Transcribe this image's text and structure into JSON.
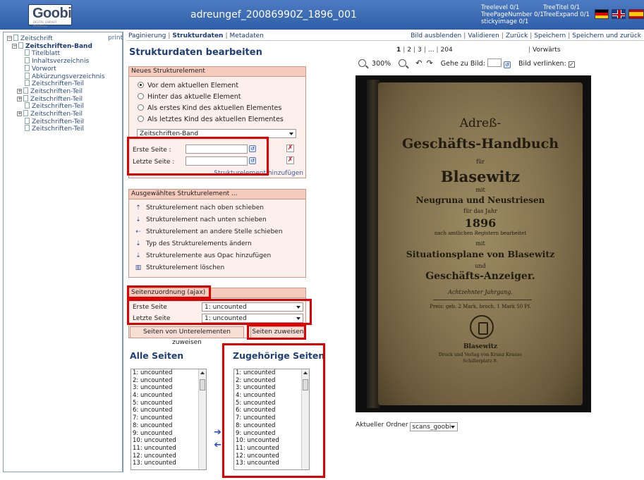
{
  "header": {
    "logo_text": "Goobi",
    "logo_subtext": "DIGITAL LIBRARY MODULES",
    "document_title": "adreungef_20086990Z_1896_001",
    "meta_left": [
      "Treelevel 0/1",
      "TreePageNumber 0/1",
      "stickyimage 0/1"
    ],
    "meta_right": [
      "TreeTitel 0/1",
      "TreeExpand 0/1"
    ]
  },
  "tree": {
    "print_label": "print",
    "nodes": [
      {
        "label": "Zeitschrift",
        "expander": "−",
        "level": 0
      },
      {
        "label": "Zeitschriften-Band",
        "expander": "−",
        "level": 1,
        "bold": true
      },
      {
        "label": "Titelblatt",
        "expander": "",
        "level": 2
      },
      {
        "label": "Inhaltsverzeichnis",
        "expander": "",
        "level": 2
      },
      {
        "label": "Vorwort",
        "expander": "",
        "level": 2
      },
      {
        "label": "Abkürzungsverzeichnis",
        "expander": "",
        "level": 2
      },
      {
        "label": "Zeitschriften-Teil",
        "expander": "",
        "level": 2
      },
      {
        "label": "Zeitschriften-Teil",
        "expander": "+",
        "level": 2
      },
      {
        "label": "Zeitschriften-Teil",
        "expander": "+",
        "level": 2
      },
      {
        "label": "Zeitschriften-Teil",
        "expander": "",
        "level": 2
      },
      {
        "label": "Zeitschriften-Teil",
        "expander": "+",
        "level": 2
      },
      {
        "label": "Zeitschriften-Teil",
        "expander": "",
        "level": 2
      },
      {
        "label": "Zeitschriften-Teil",
        "expander": "",
        "level": 2
      }
    ]
  },
  "toolbar": {
    "paginierung": "Paginierung",
    "strukturdaten": "Strukturdaten",
    "metadaten": "Metadaten",
    "bild_ausblenden": "Bild ausblenden",
    "validieren": "Validieren",
    "zurueck": "Zurück",
    "speichern": "Speichern",
    "speichern_und_zurueck": "Speichern und zurück"
  },
  "main_title": "Strukturdaten bearbeiten",
  "new_element": {
    "header": "Neues Strukturelement",
    "options": [
      {
        "label": "Vor dem aktuellen Element",
        "selected": true
      },
      {
        "label": "Hinter das aktuelle Element",
        "selected": false
      },
      {
        "label": "Als erstes Kind des aktuellen Elementes",
        "selected": false
      },
      {
        "label": "Als letztes Kind des aktuellen Elementes",
        "selected": false
      }
    ],
    "type_value": "Zeitschriften-Band",
    "erste_seite_label": "Erste Seite :",
    "letzte_seite_label": "Letzte Seite :",
    "add_link": "Strukturelement hinzufügen"
  },
  "selected_element": {
    "header": "Ausgewähltes Strukturelement ...",
    "actions": [
      {
        "label": "Strukturelement nach oben schieben",
        "icon": "arrow-up-icon",
        "glyph": "⇡"
      },
      {
        "label": "Strukturelement nach unten schieben",
        "icon": "arrow-down-icon",
        "glyph": "⇣"
      },
      {
        "label": "Strukturelement an andere Stelle schieben",
        "icon": "arrow-left-icon",
        "glyph": "⇠"
      },
      {
        "label": "Typ des Strukturelements ändern",
        "icon": "change-type-icon",
        "glyph": "⇣"
      },
      {
        "label": "Strukturelemente aus Opac hinzufügen",
        "icon": "opac-add-icon",
        "glyph": "⇣"
      },
      {
        "label": "Strukturelement löschen",
        "icon": "trash-icon",
        "glyph": "▥"
      }
    ]
  },
  "page_assignment": {
    "header": "Seitenzuordnung (ajax)",
    "erste_seite_label": "Erste Seite",
    "letzte_seite_label": "Letzte Seite",
    "erste_seite_value": "1: uncounted",
    "letzte_seite_value": "1: uncounted",
    "assign_children_button": "Seiten von Unterelementen zuweisen",
    "assign_button": "Seiten zuweisen"
  },
  "all_pages": {
    "title": "Alle Seiten",
    "items": [
      "1: uncounted",
      "2: uncounted",
      "3: uncounted",
      "4: uncounted",
      "5: uncounted",
      "6: uncounted",
      "7: uncounted",
      "8: uncounted",
      "9: uncounted",
      "10: uncounted",
      "11: uncounted",
      "12: uncounted",
      "13: uncounted"
    ]
  },
  "assigned_pages": {
    "title": "Zugehörige Seiten",
    "items": [
      "1: uncounted",
      "2: uncounted",
      "3: uncounted",
      "4: uncounted",
      "5: uncounted",
      "6: uncounted",
      "7: uncounted",
      "8: uncounted",
      "9: uncounted",
      "10: uncounted",
      "11: uncounted",
      "12: uncounted",
      "13: uncounted"
    ]
  },
  "viewer": {
    "pager_pages": [
      "1",
      "2",
      "3",
      "...",
      "204"
    ],
    "pager_next": "Vorwärts",
    "zoom_value": "300%",
    "goto_label": "Gehe zu Bild:",
    "link_image_label": "Bild verlinken:",
    "link_image_checked": true,
    "folder_label": "Aktueller Ordner",
    "folder_value": "scans_goobi"
  },
  "scan_text": {
    "line1": "Adreß-",
    "line2": "Geschäfts-Handbuch",
    "line3": "für",
    "line4": "Blasewitz",
    "line5": "mit",
    "line6": "Neugruna und Neustriesen",
    "line7": "für das Jahr",
    "line8": "1896",
    "line9": "nach amtlichen Registern bearbeitet",
    "line10": "mit",
    "line11": "Situationsplane von Blasewitz",
    "line12": "und",
    "line13": "Geschäfts-Anzeiger.",
    "line14": "Achtzehnter Jahrgang.",
    "line15": "Preis: geb. 2 Mark, broch. 1 Mark 50 Pf.",
    "line16": "Blasewitz",
    "line17": "Druck und Verlag von Kranz Krause",
    "line18": "Schillerplatz 8."
  }
}
